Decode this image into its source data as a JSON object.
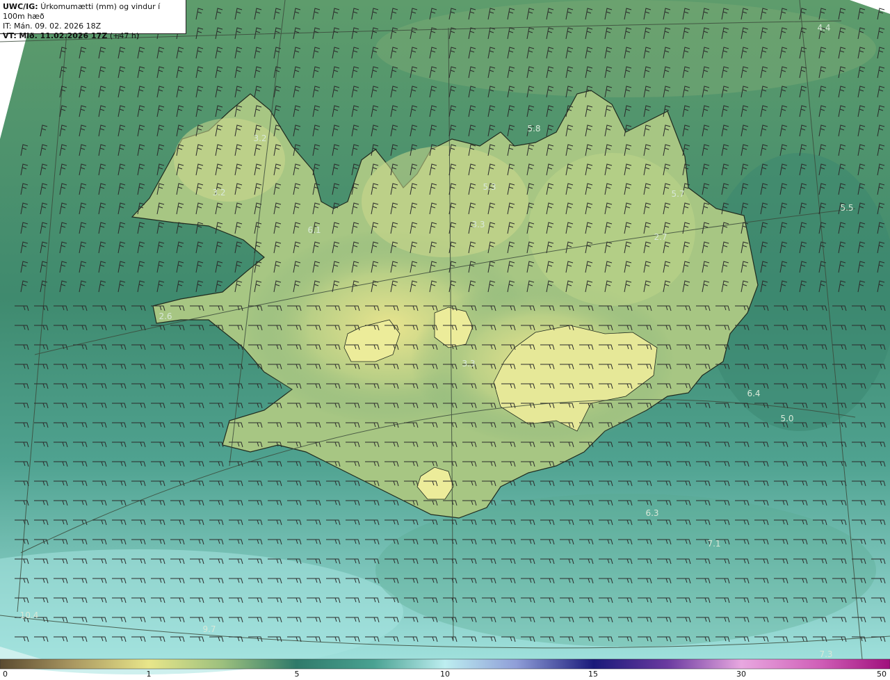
{
  "header": {
    "model_code": "UWC/IG:",
    "title": "Úrkomumætti (mm) og vindur í 100m hæð",
    "init_time": "IT: Mán. 09. 02. 2026 18Z",
    "valid_prefix": "VT:",
    "valid_time": "Mið. 11.02.2026 17Z",
    "lead": "(+47 h)"
  },
  "colorbar": {
    "ticks": [
      "0",
      "1",
      "5",
      "10",
      "15",
      "30",
      "50"
    ],
    "colors": [
      "#6b5a3e",
      "#b8a66a",
      "#e8e68a",
      "#c6d98c",
      "#6aa876",
      "#2e7a6e",
      "#9fe0df",
      "#d6f2f4",
      "#3d3fa8",
      "#1a1a7a",
      "#b24ab8",
      "#f4b8e8",
      "#c01a8c"
    ]
  },
  "values": [
    {
      "text": "4.4"
    },
    {
      "text": "5.8"
    },
    {
      "text": "3.2"
    },
    {
      "text": "3.2"
    },
    {
      "text": "5.3"
    },
    {
      "text": "5.7"
    },
    {
      "text": "5.5"
    },
    {
      "text": "6.1"
    },
    {
      "text": "3.3"
    },
    {
      "text": "2.7"
    },
    {
      "text": "2.6"
    },
    {
      "text": "3.3"
    },
    {
      "text": "6.4"
    },
    {
      "text": "5.0"
    },
    {
      "text": "6.3"
    },
    {
      "text": "7.1"
    },
    {
      "text": "10.4"
    },
    {
      "text": "9.7"
    },
    {
      "text": "7.3"
    }
  ]
}
